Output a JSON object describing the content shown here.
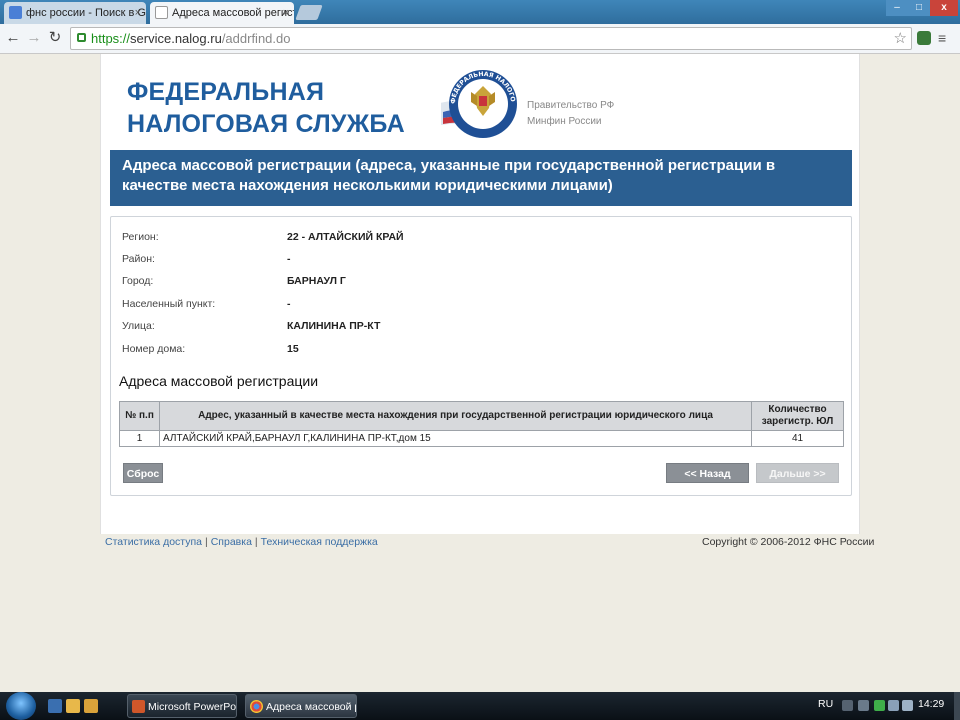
{
  "browser": {
    "tabs": [
      {
        "label": "фнс россии - Поиск в Go",
        "active": false
      },
      {
        "label": "Адреса массовой регистр",
        "active": true
      }
    ],
    "tab_close_glyph": "×",
    "url_scheme": "https://",
    "url_host": "service.nalog.ru",
    "url_path": "/addrfind.do",
    "buttons": {
      "back": "←",
      "forward": "→",
      "reload": "↻",
      "bookmark": "☆",
      "menu": "≡"
    },
    "window": {
      "minimize": "–",
      "maximize": "□",
      "close": "x"
    }
  },
  "header": {
    "logo_line1": "ФЕДЕРАЛЬНАЯ",
    "logo_line2": "НАЛОГОВАЯ СЛУЖБА",
    "emblem_text": "ФЕДЕРАЛЬНАЯ НАЛОГОВАЯ СЛУЖБА",
    "side_link1": "Правительство РФ",
    "side_link2": "Минфин России"
  },
  "banner": {
    "title": "Адреса массовой регистрации (адреса, указанные при государственной регистрации в качестве места нахождения несколькими юридическими лицами)"
  },
  "fields": [
    {
      "label": "Регион:",
      "value": "22 - АЛТАЙСКИЙ КРАЙ"
    },
    {
      "label": "Район:",
      "value": "-"
    },
    {
      "label": "Город:",
      "value": "БАРНАУЛ Г"
    },
    {
      "label": "Населенный пункт:",
      "value": "-"
    },
    {
      "label": "Улица:",
      "value": "КАЛИНИНА ПР-КТ"
    },
    {
      "label": "Номер дома:",
      "value": "15"
    }
  ],
  "results": {
    "title": "Адреса массовой регистрации",
    "columns": [
      "№ п.п",
      "Адрес, указанный в качестве места нахождения при государственной регистрации юридического лица",
      "Количество зарегистр. ЮЛ"
    ],
    "rows": [
      {
        "num": "1",
        "address": "АЛТАЙСКИЙ КРАЙ,БАРНАУЛ Г,КАЛИНИНА ПР-КТ,дом 15",
        "count": "41"
      }
    ]
  },
  "actions": {
    "reset": "Сброс",
    "back": "<< Назад",
    "next": "Дальше >>"
  },
  "footer": {
    "links": [
      "Статистика доступа",
      "Справка",
      "Техническая поддержка"
    ],
    "separator": "|",
    "copyright": "Copyright © 2006-2012 ФНС России"
  },
  "taskbar": {
    "tasks": [
      "Microsoft PowerPoi...",
      "Адреса массовой р..."
    ],
    "lang": "RU",
    "time": "14:29"
  },
  "colors": {
    "brand_blue": "#1f5d9e",
    "banner": "#2b5f91",
    "button": "#8b9096"
  }
}
